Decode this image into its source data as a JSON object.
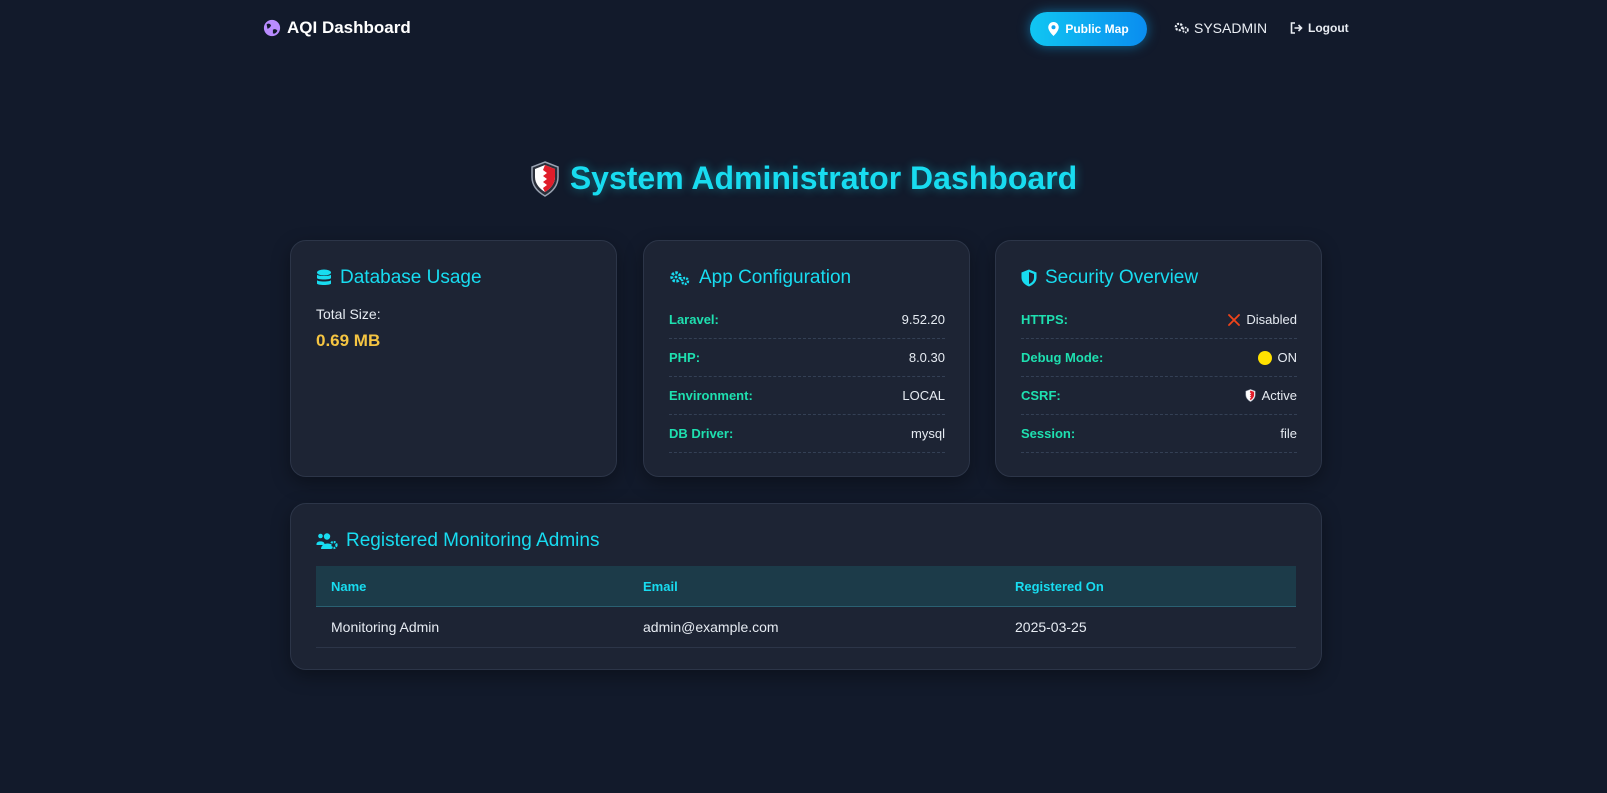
{
  "navbar": {
    "brand": "AQI Dashboard",
    "public_map": "Public Map",
    "user": "SYSADMIN",
    "logout": "Logout"
  },
  "page": {
    "title": "System Administrator Dashboard"
  },
  "database": {
    "title": "Database Usage",
    "total_label": "Total Size:",
    "total_value": "0.69 MB"
  },
  "app_config": {
    "title": "App Configuration",
    "rows": [
      {
        "key": "Laravel:",
        "value": "9.52.20"
      },
      {
        "key": "PHP:",
        "value": "8.0.30"
      },
      {
        "key": "Environment:",
        "value": "LOCAL"
      },
      {
        "key": "DB Driver:",
        "value": "mysql"
      }
    ]
  },
  "security": {
    "title": "Security Overview",
    "rows": [
      {
        "key": "HTTPS:",
        "value": "Disabled",
        "icon": "cross-icon"
      },
      {
        "key": "Debug Mode:",
        "value": "ON",
        "icon": "yellow-circle-icon"
      },
      {
        "key": "CSRF:",
        "value": "Active",
        "icon": "shield-icon"
      },
      {
        "key": "Session:",
        "value": "file"
      }
    ]
  },
  "admins": {
    "title": "Registered Monitoring Admins",
    "columns": [
      "Name",
      "Email",
      "Registered On"
    ],
    "rows": [
      [
        "Monitoring Admin",
        "admin@example.com",
        "2025-03-25"
      ]
    ]
  },
  "colors": {
    "accent": "#18dcf0",
    "key_green": "#1ee0b0",
    "value_yellow": "#f5c542",
    "background": "#121a2b",
    "card": "#1d2434"
  }
}
